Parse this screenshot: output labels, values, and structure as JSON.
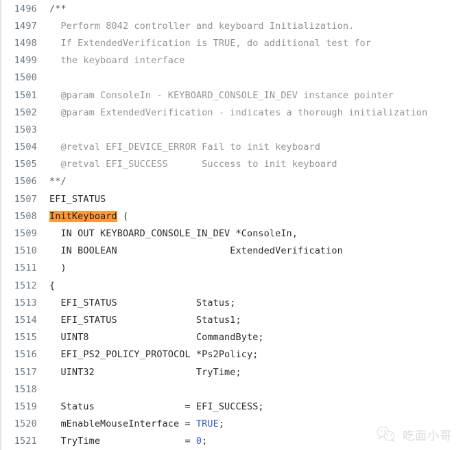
{
  "viewer": {
    "name": "source-code-viewer",
    "background_color": "#ffffff",
    "gutter_color": "#6d7a85",
    "comment_color": "#8d9499",
    "code_color": "#2b2b2b",
    "keyword_color": "#2f5fc0",
    "highlight_color": "#ff9933",
    "border_color": "#dfe4ea",
    "first_line_number": 1496,
    "last_line_number": 1521
  },
  "lines": [
    {
      "number": "1496",
      "segments": [
        {
          "text": "/**",
          "kind": "comment-mark"
        }
      ]
    },
    {
      "number": "1497",
      "segments": [
        {
          "text": "  Perform 8042 controller and keyboard Initialization.",
          "kind": "comment"
        }
      ]
    },
    {
      "number": "1498",
      "segments": [
        {
          "text": "  If ExtendedVerification is TRUE, do additional test for",
          "kind": "comment"
        }
      ]
    },
    {
      "number": "1499",
      "segments": [
        {
          "text": "  the keyboard interface",
          "kind": "comment"
        }
      ]
    },
    {
      "number": "1500",
      "segments": [
        {
          "text": "",
          "kind": "comment"
        }
      ]
    },
    {
      "number": "1501",
      "segments": [
        {
          "text": "  @param ConsoleIn - KEYBOARD_CONSOLE_IN_DEV instance pointer",
          "kind": "comment"
        }
      ]
    },
    {
      "number": "1502",
      "segments": [
        {
          "text": "  @param ExtendedVerification - indicates a thorough initialization",
          "kind": "comment"
        }
      ]
    },
    {
      "number": "1503",
      "segments": [
        {
          "text": "",
          "kind": "comment"
        }
      ]
    },
    {
      "number": "1504",
      "segments": [
        {
          "text": "  @retval EFI_DEVICE_ERROR Fail to init keyboard",
          "kind": "comment"
        }
      ]
    },
    {
      "number": "1505",
      "segments": [
        {
          "text": "  @retval EFI_SUCCESS      Success to init keyboard",
          "kind": "comment"
        }
      ]
    },
    {
      "number": "1506",
      "segments": [
        {
          "text": "**/",
          "kind": "comment-mark"
        }
      ]
    },
    {
      "number": "1507",
      "segments": [
        {
          "text": "EFI_STATUS",
          "kind": "code"
        }
      ]
    },
    {
      "number": "1508",
      "segments": [
        {
          "text": "InitKeyboard",
          "kind": "highlight"
        },
        {
          "text": " (",
          "kind": "code"
        }
      ]
    },
    {
      "number": "1509",
      "segments": [
        {
          "text": "  IN OUT KEYBOARD_CONSOLE_IN_DEV *ConsoleIn,",
          "kind": "code"
        }
      ]
    },
    {
      "number": "1510",
      "segments": [
        {
          "text": "  IN BOOLEAN                    ExtendedVerification",
          "kind": "code"
        }
      ]
    },
    {
      "number": "1511",
      "segments": [
        {
          "text": "  )",
          "kind": "code"
        }
      ]
    },
    {
      "number": "1512",
      "segments": [
        {
          "text": "{",
          "kind": "code"
        }
      ]
    },
    {
      "number": "1513",
      "segments": [
        {
          "text": "  EFI_STATUS              Status;",
          "kind": "code"
        }
      ]
    },
    {
      "number": "1514",
      "segments": [
        {
          "text": "  EFI_STATUS              Status1;",
          "kind": "code"
        }
      ]
    },
    {
      "number": "1515",
      "segments": [
        {
          "text": "  UINT8                   CommandByte;",
          "kind": "code"
        }
      ]
    },
    {
      "number": "1516",
      "segments": [
        {
          "text": "  EFI_PS2_POLICY_PROTOCOL *Ps2Policy;",
          "kind": "code"
        }
      ]
    },
    {
      "number": "1517",
      "segments": [
        {
          "text": "  UINT32                  TryTime;",
          "kind": "code"
        }
      ]
    },
    {
      "number": "1518",
      "segments": [
        {
          "text": "",
          "kind": "code"
        }
      ]
    },
    {
      "number": "1519",
      "segments": [
        {
          "text": "  Status                = EFI_SUCCESS;",
          "kind": "code"
        }
      ]
    },
    {
      "number": "1520",
      "segments": [
        {
          "text": "  mEnableMouseInterface = ",
          "kind": "code"
        },
        {
          "text": "TRUE",
          "kind": "keyword"
        },
        {
          "text": ";",
          "kind": "code"
        }
      ]
    },
    {
      "number": "1521",
      "segments": [
        {
          "text": "  TryTime               = ",
          "kind": "code"
        },
        {
          "text": "0",
          "kind": "number"
        },
        {
          "text": ";",
          "kind": "code"
        }
      ]
    }
  ],
  "watermark": {
    "icon": "wechat-icon",
    "text": "吃面小哥",
    "color": "#d6d6d6"
  }
}
